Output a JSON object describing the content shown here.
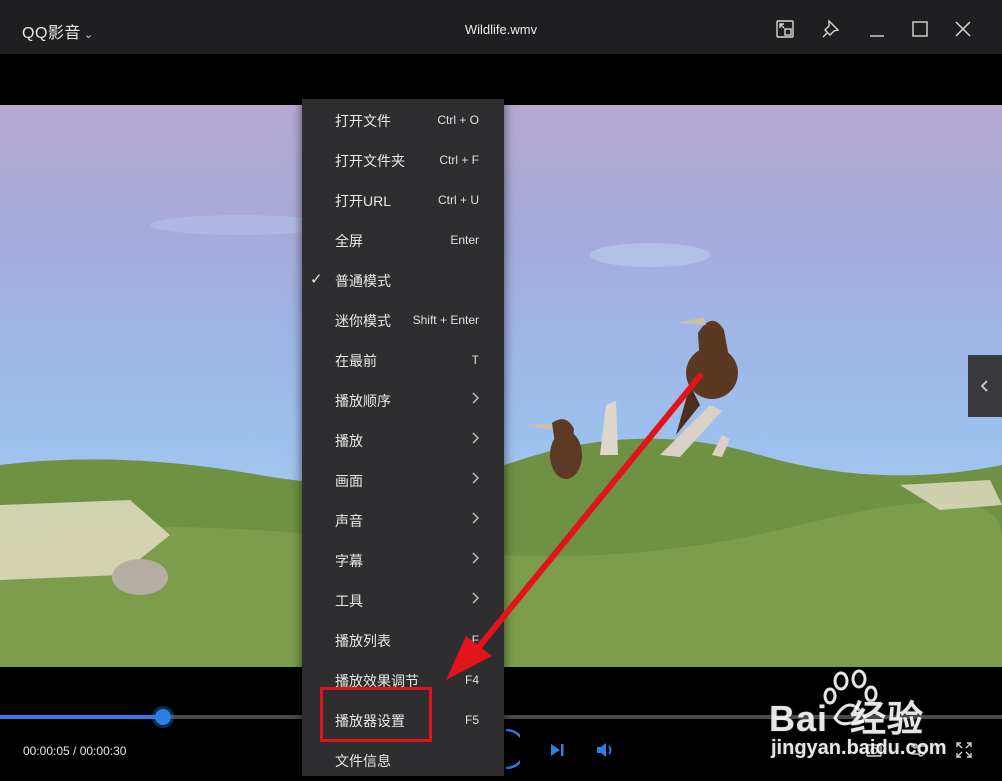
{
  "app": {
    "name": "QQ影音",
    "file_title": "Wildlife.wmv"
  },
  "playback": {
    "time_display": "00:00:05 / 00:00:30",
    "progress_fraction": 0.163
  },
  "context_menu": {
    "items": [
      {
        "label": "打开文件",
        "shortcut": "Ctrl + O",
        "checked": false,
        "submenu": false
      },
      {
        "label": "打开文件夹",
        "shortcut": "Ctrl + F",
        "checked": false,
        "submenu": false
      },
      {
        "label": "打开URL",
        "shortcut": "Ctrl + U",
        "checked": false,
        "submenu": false
      },
      {
        "label": "全屏",
        "shortcut": "Enter",
        "checked": false,
        "submenu": false
      },
      {
        "label": "普通模式",
        "shortcut": "",
        "checked": true,
        "submenu": false
      },
      {
        "label": "迷你模式",
        "shortcut": "Shift + Enter",
        "checked": false,
        "submenu": false
      },
      {
        "label": "在最前",
        "shortcut": "T",
        "checked": false,
        "submenu": false
      },
      {
        "label": "播放顺序",
        "shortcut": "",
        "checked": false,
        "submenu": true
      },
      {
        "label": "播放",
        "shortcut": "",
        "checked": false,
        "submenu": true
      },
      {
        "label": "画面",
        "shortcut": "",
        "checked": false,
        "submenu": true
      },
      {
        "label": "声音",
        "shortcut": "",
        "checked": false,
        "submenu": true
      },
      {
        "label": "字幕",
        "shortcut": "",
        "checked": false,
        "submenu": true
      },
      {
        "label": "工具",
        "shortcut": "",
        "checked": false,
        "submenu": true
      },
      {
        "label": "播放列表",
        "shortcut": "F",
        "checked": false,
        "submenu": false
      },
      {
        "label": "播放效果调节",
        "shortcut": "F4",
        "checked": false,
        "submenu": false
      },
      {
        "label": "播放器设置",
        "shortcut": "F5",
        "checked": false,
        "submenu": false
      },
      {
        "label": "文件信息",
        "shortcut": "",
        "checked": false,
        "submenu": false
      }
    ],
    "highlighted_item": "播放器设置"
  },
  "watermark": {
    "brand": "Bai  经验",
    "url": "jingyan.baidu.com"
  },
  "colors": {
    "titlebar": "#1f1f21",
    "menu_bg": "#2e2e30",
    "accent": "#2e7ee5",
    "annotation_red": "#e1141c"
  },
  "icons": [
    "chevron-down-icon",
    "picture-in-picture-icon",
    "pin-icon",
    "minimize-icon",
    "maximize-icon",
    "close-icon",
    "chevron-left-icon",
    "checkmark-icon",
    "submenu-arrow-icon",
    "next-icon",
    "volume-icon",
    "screenshot-icon",
    "settings-icon",
    "fullscreen-icon",
    "red-arrow-annotation",
    "baidu-paw-logo"
  ]
}
